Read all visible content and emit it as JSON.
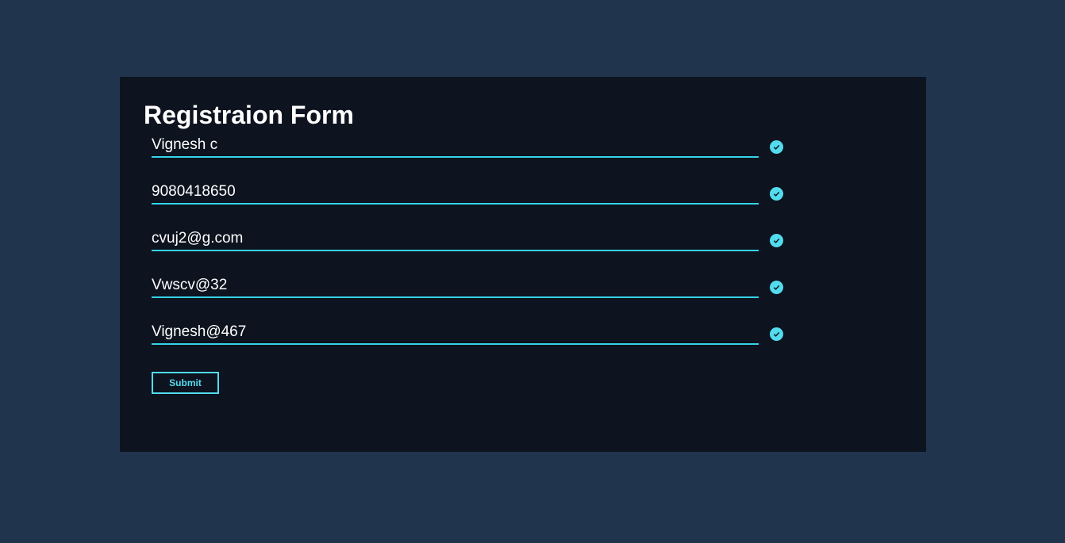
{
  "form": {
    "title": "Registraion Form",
    "fields": [
      {
        "value": "Vignesh c"
      },
      {
        "value": "9080418650"
      },
      {
        "value": "cvuj2@g.com"
      },
      {
        "value": "Vwscv@32"
      },
      {
        "value": "Vignesh@467"
      }
    ],
    "submit_label": "Submit"
  },
  "colors": {
    "page_background": "#21344e",
    "card_background": "#0d131f",
    "accent": "#35d4e8",
    "check_fill": "#52dced",
    "text": "#ffffff"
  },
  "icons": {
    "valid": "check-circle-icon"
  }
}
